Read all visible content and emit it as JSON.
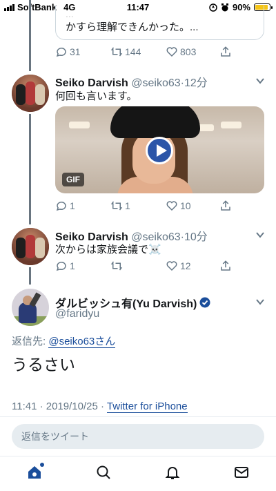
{
  "status_bar": {
    "carrier": "SoftBank",
    "network": "4G",
    "time": "11:47",
    "battery": "90%",
    "battery_level": 0.9
  },
  "previous_quote": {
    "faded_text": "...",
    "text": "かすら理解できんかった。..."
  },
  "thread": [
    {
      "actions": {
        "replies": "31",
        "retweets": "144",
        "likes": "803"
      }
    },
    {
      "name": "Seiko Darvish",
      "handle": "@seiko63",
      "time": "12分",
      "text": "何回も言います。",
      "media_badge": "GIF",
      "actions": {
        "replies": "1",
        "retweets": "1",
        "likes": "10"
      }
    },
    {
      "name": "Seiko Darvish",
      "handle": "@seiko63",
      "time": "10分",
      "text": "次からは家族会議で☠️",
      "actions": {
        "replies": "1",
        "retweets": "",
        "likes": "12"
      }
    }
  ],
  "focused_tweet": {
    "name": "ダルビッシュ有(Yu Darvish)",
    "handle": "@faridyu",
    "reply_to_label": "返信先: ",
    "reply_to_user": "@seiko63さん",
    "text": "うるさい",
    "timestamp": "11:41 · 2019/10/25 · ",
    "source": "Twitter for iPhone"
  },
  "compose": {
    "placeholder": "返信をツイート"
  },
  "tabbar": {
    "items": [
      "home-icon",
      "search-icon",
      "notifications-icon",
      "messages-icon"
    ]
  },
  "colors": {
    "accent": "#1b4e9b",
    "muted": "#657786",
    "thread_line": "#697580"
  }
}
